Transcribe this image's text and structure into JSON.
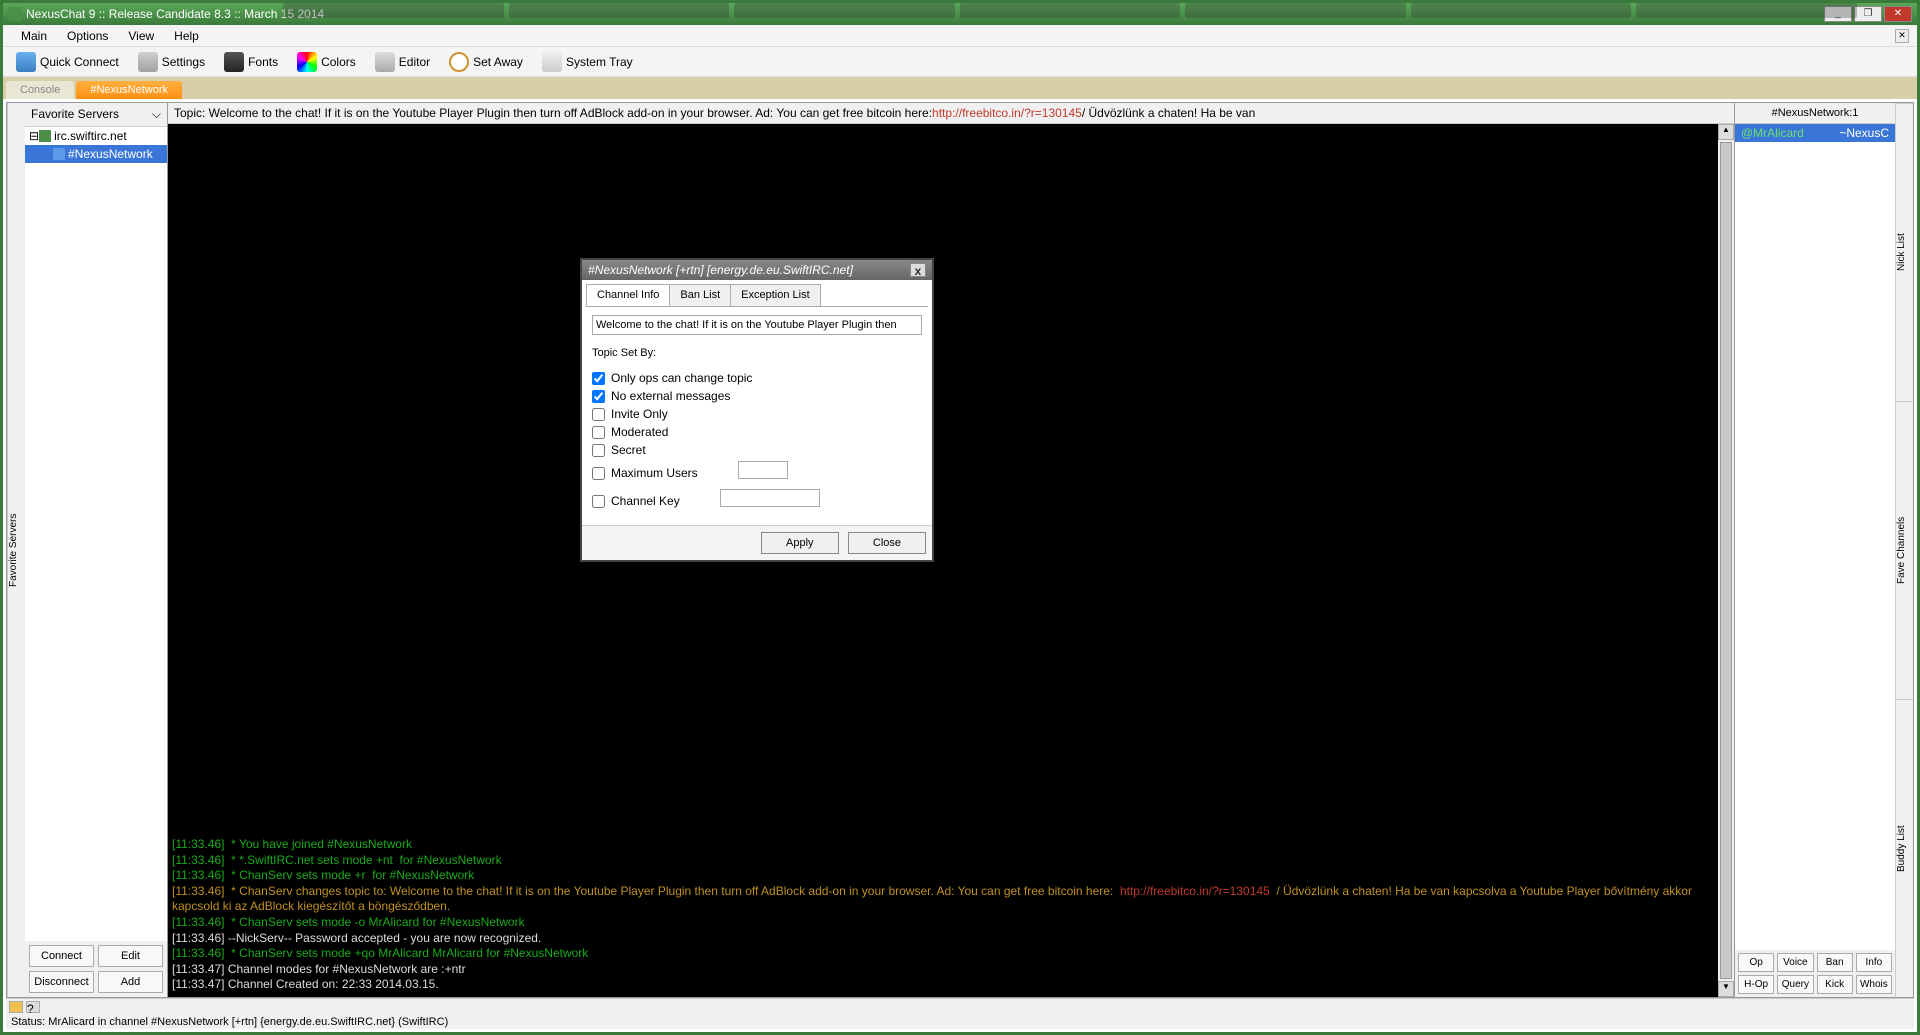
{
  "window": {
    "title": "NexusChat 9 :: Release Candidate 8.3 :: March 15 2014"
  },
  "menubar": {
    "items": [
      "Main",
      "Options",
      "View",
      "Help"
    ]
  },
  "toolbar": {
    "quick_connect": "Quick Connect",
    "settings": "Settings",
    "fonts": "Fonts",
    "colors": "Colors",
    "editor": "Editor",
    "set_away": "Set Away",
    "system_tray": "System Tray"
  },
  "tabs": {
    "console": "Console",
    "channel": "#NexusNetwork"
  },
  "sidebar": {
    "fav_tab": "Favorite Servers",
    "header": "Favorite Servers",
    "server": "irc.swiftirc.net",
    "channel": "#NexusNetwork",
    "btn_connect": "Connect",
    "btn_edit": "Edit",
    "btn_disconnect": "Disconnect",
    "btn_add": "Add"
  },
  "topic": {
    "prefix": "Topic: Welcome to the chat! If it is on the Youtube Player Plugin then turn off AdBlock add-on in your browser. Ad: You can get free bitcoin here: ",
    "link": "http://freebitco.in/?r=130145",
    "suffix": " / Üdvözlünk a chaten! Ha be van"
  },
  "chat": {
    "lines": [
      {
        "cls": "cl-green",
        "text": "[11:33.46]  * You have joined #NexusNetwork"
      },
      {
        "cls": "cl-green",
        "text": "[11:33.46]  * *.SwiftIRC.net sets mode +nt  for #NexusNetwork"
      },
      {
        "cls": "cl-green",
        "text": "[11:33.46]  * ChanServ sets mode +r  for #NexusNetwork"
      },
      {
        "cls": "cl-gold link",
        "text": "[11:33.46]  * ChanServ changes topic to: Welcome to the chat! If it is on the Youtube Player Plugin then turn off AdBlock add-on in your browser. Ad: You can get free bitcoin here:  http://freebitco.in/?r=130145  / Üdvözlünk a chaten! Ha be van kapcsolva a Youtube Player bővítmény akkor kapcsold ki az AdBlock kiegészítőt a böngésződben."
      },
      {
        "cls": "cl-green",
        "text": "[11:33.46]  * ChanServ sets mode -o MrAlicard for #NexusNetwork"
      },
      {
        "cls": "cl-white",
        "text": "[11:33.46] --NickServ-- Password accepted - you are now recognized."
      },
      {
        "cls": "cl-green",
        "text": "[11:33.46]  * ChanServ sets mode +qo MrAlicard MrAlicard for #NexusNetwork"
      },
      {
        "cls": "cl-white",
        "text": "[11:33.47] Channel modes for #NexusNetwork are :+ntr"
      },
      {
        "cls": "cl-white",
        "text": "[11:33.47] Channel Created on: 22:33 2014.03.15."
      }
    ]
  },
  "nicklist": {
    "header": "#NexusNetwork:1",
    "nick_prefix": "@MrAlicard",
    "nick_suffix": "~NexusC",
    "tabs": [
      "Nick List",
      "Fave Channels",
      "Buddy List"
    ],
    "btn_op": "Op",
    "btn_voice": "Voice",
    "btn_ban": "Ban",
    "btn_info": "Info",
    "btn_hop": "H-Op",
    "btn_query": "Query",
    "btn_kick": "Kick",
    "btn_whois": "Whois"
  },
  "status": {
    "text": "Status: MrAlicard in channel #NexusNetwork [+rtn] {energy.de.eu.SwiftIRC.net} (SwiftIRC)"
  },
  "dialog": {
    "title": "#NexusNetwork [+rtn]  [energy.de.eu.SwiftIRC.net]",
    "tabs": [
      "Channel Info",
      "Ban List",
      "Exception List"
    ],
    "topic_value": "Welcome to the chat! If it is on the Youtube Player Plugin then ",
    "topic_set_by": "Topic Set By:",
    "opts": {
      "only_ops": "Only ops can change topic",
      "no_external": "No external messages",
      "invite_only": "Invite Only",
      "moderated": "Moderated",
      "secret": "Secret",
      "max_users": "Maximum Users",
      "channel_key": "Channel Key"
    },
    "btn_apply": "Apply",
    "btn_close": "Close"
  }
}
